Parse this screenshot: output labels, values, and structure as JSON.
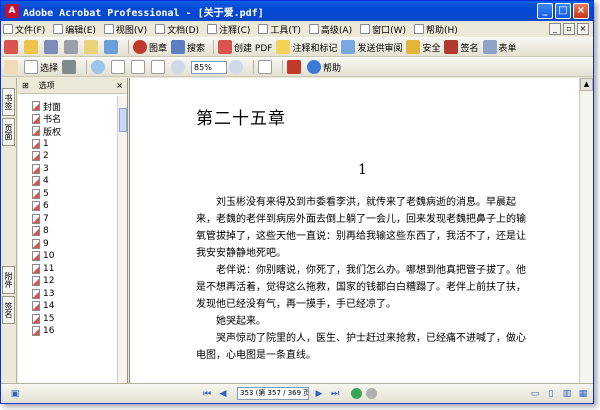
{
  "window": {
    "title": "Adobe Acrobat Professional - [关于爱.pdf]",
    "app_icon": "acrobat-icon"
  },
  "menu": [
    "文件(F)",
    "编辑(E)",
    "视图(V)",
    "文档(D)",
    "注释(C)",
    "工具(T)",
    "高级(A)",
    "窗口(W)",
    "帮助(H)"
  ],
  "toolbar1": {
    "buttons": [
      "图章",
      "搜索",
      "创建 PDF",
      "注释和标记",
      "发送供审阅",
      "安全",
      "签名",
      "表单"
    ]
  },
  "toolbar2": {
    "select_label": "选择",
    "zoom": "85%",
    "help_label": "帮助"
  },
  "panel": {
    "options_label": "选项",
    "close": "×",
    "bookmarks": [
      "封面",
      "书名",
      "版权",
      "1",
      "2",
      "3",
      "4",
      "5",
      "6",
      "7",
      "8",
      "9",
      "10",
      "11",
      "12",
      "13",
      "14",
      "15",
      "16"
    ]
  },
  "left_tabs": {
    "bookmarks": "书签",
    "pages": "页面",
    "attachments": "附件",
    "signatures": "签名"
  },
  "document": {
    "chapter_title": "第二十五章",
    "section_number": "1",
    "paragraphs": [
      "刘玉彬没有来得及到市委看李洪，就传来了老魏病逝的消息。早晨起来，老魏的老伴到病房外面去倒上躺了一会儿，回来发现老魏把鼻子上的输氧管拔掉了，这些天他一直说：别再给我输这些东西了，我活不了，还是让我安安静静地死吧。",
      "老伴说：你别瞎说，你死了，我们怎么办。哪想到他真把管子拔了。他是不想再活着，觉得这么拖救，国家的钱都白白糟蹋了。老伴上前扶了扶，发现他已经没有气，再一摸手，手已经凉了。",
      "她哭起来。",
      "哭声惊动了院里的人，医生、护士赶过来抢救，已经痛不进喊了，做心电图，心电图是一条直线。"
    ]
  },
  "status": {
    "page_field": "353 (第 357 / 369 页)"
  },
  "colors": {
    "titlebar": "#0a48c8",
    "chrome": "#ece9d8",
    "accent": "#2f62c7"
  }
}
